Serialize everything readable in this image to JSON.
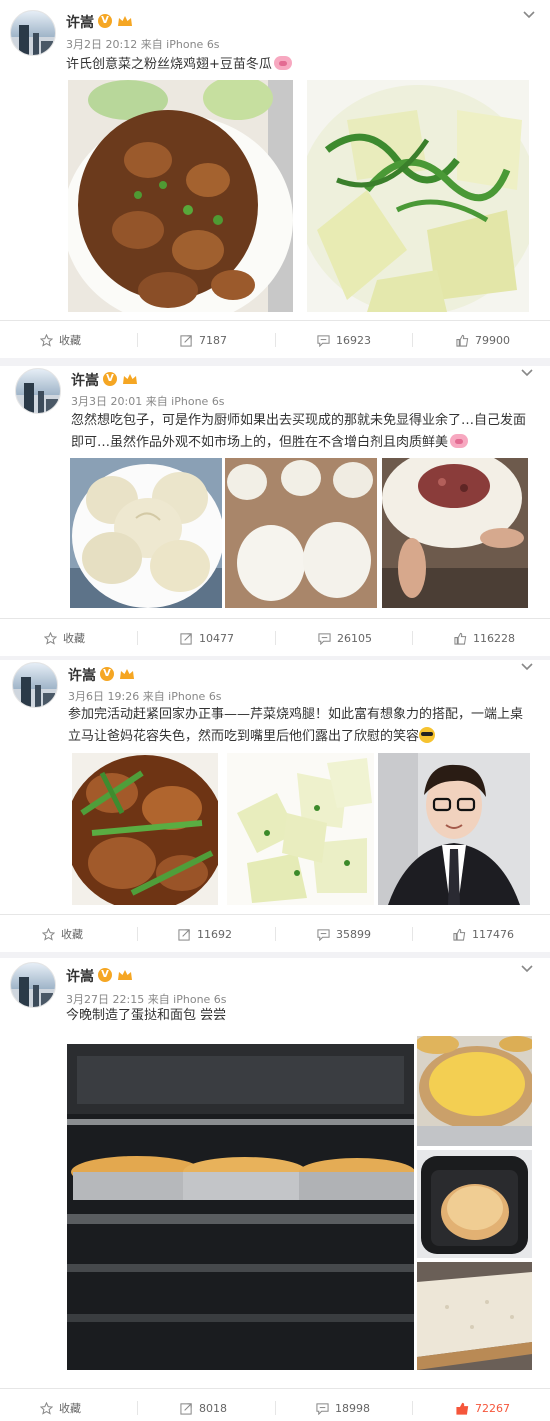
{
  "posts": [
    {
      "user": "许嵩",
      "meta": "3月2日 20:12 来自 iPhone 6s",
      "text": "许氏创意菜之粉丝烧鸡翅+豆苗冬瓜",
      "actions": {
        "favorite": "收藏",
        "repost": "7187",
        "comment": "16923",
        "like": "79900"
      },
      "images": [
        "braised-chicken-wings-photo",
        "pea-shoots-winter-melon-photo"
      ]
    },
    {
      "user": "许嵩",
      "meta": "3月3日 20:01 来自 iPhone 6s",
      "text": "忽然想吃包子，可是作为厨师如果出去买现成的那就未免显得业余了…自己发面即可…虽然作品外观不如市场上的，但胜在不含增白剂且肉质鲜美",
      "actions": {
        "favorite": "收藏",
        "repost": "10477",
        "comment": "26105",
        "like": "116228"
      },
      "images": [
        "steamed-buns-photo",
        "dough-photo",
        "meat-filling-photo"
      ]
    },
    {
      "user": "许嵩",
      "meta": "3月6日 19:26 来自 iPhone 6s",
      "text": "参加完活动赶紧回家办正事——芹菜烧鸡腿！如此富有想象力的搭配，一端上桌立马让爸妈花容失色，然而吃到嘴里后他们露出了欣慰的笑容",
      "actions": {
        "favorite": "收藏",
        "repost": "11692",
        "comment": "35899",
        "like": "117476"
      },
      "images": [
        "celery-chicken-legs-photo",
        "winter-melon-photo",
        "selfie-photo"
      ]
    },
    {
      "user": "许嵩",
      "meta": "3月27日 22:15 来自 iPhone 6s",
      "text": "今晚制造了蛋挞和面包 尝尝",
      "actions": {
        "favorite": "收藏",
        "repost": "8018",
        "comment": "18998",
        "like": "72267"
      },
      "images": [
        "oven-egg-tarts-photo",
        "egg-tart-closeup-photo",
        "bread-machine-photo",
        "bread-slice-photo"
      ]
    }
  ],
  "colors": {
    "like_active": "#f5563b",
    "vip_badge": "#f5a623",
    "separator": "#f2f2f5"
  }
}
